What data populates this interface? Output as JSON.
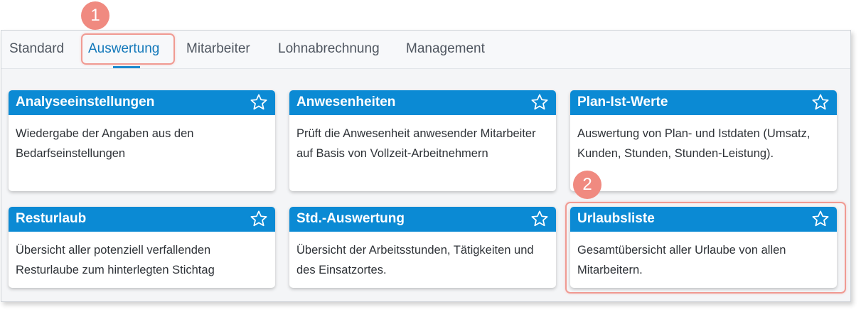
{
  "tabs": [
    {
      "label": "Standard",
      "active": false
    },
    {
      "label": "Auswertung",
      "active": true
    },
    {
      "label": "Mitarbeiter",
      "active": false
    },
    {
      "label": "Lohnabrechnung",
      "active": false
    },
    {
      "label": "Management",
      "active": false
    }
  ],
  "cards": [
    {
      "title": "Analyseeinstellungen",
      "description": "Wiedergabe der Angaben aus den Bedarfseinstellungen",
      "favorite_icon": "star-outline-icon"
    },
    {
      "title": "Anwesenheiten",
      "description": "Prüft die Anwesenheit anwesender Mitarbeiter auf Basis von Vollzeit-Arbeitnehmern",
      "favorite_icon": "star-outline-icon"
    },
    {
      "title": "Plan-Ist-Werte",
      "description": "Auswertung von Plan- und Istdaten (Umsatz, Kunden, Stunden, Stunden-Leistung).",
      "favorite_icon": "star-outline-icon"
    },
    {
      "title": "Resturlaub",
      "description": "Übersicht aller potenziell verfallenden Resturlaube zum hinterlegten Stichtag",
      "favorite_icon": "star-outline-icon"
    },
    {
      "title": "Std.-Auswertung",
      "description": "Übersicht der Arbeitsstunden, Tätigkeiten und des Einsatzortes.",
      "favorite_icon": "star-outline-icon"
    },
    {
      "title": "Urlaubsliste",
      "description": "Gesamtübersicht aller Urlaube von allen Mitarbeitern.",
      "favorite_icon": "star-outline-icon"
    }
  ],
  "annotations": {
    "step1": "1",
    "step2": "2"
  },
  "colors": {
    "accent": "#0b8ad4",
    "active_tab": "#1378ba",
    "annotation": "#f08a80"
  }
}
